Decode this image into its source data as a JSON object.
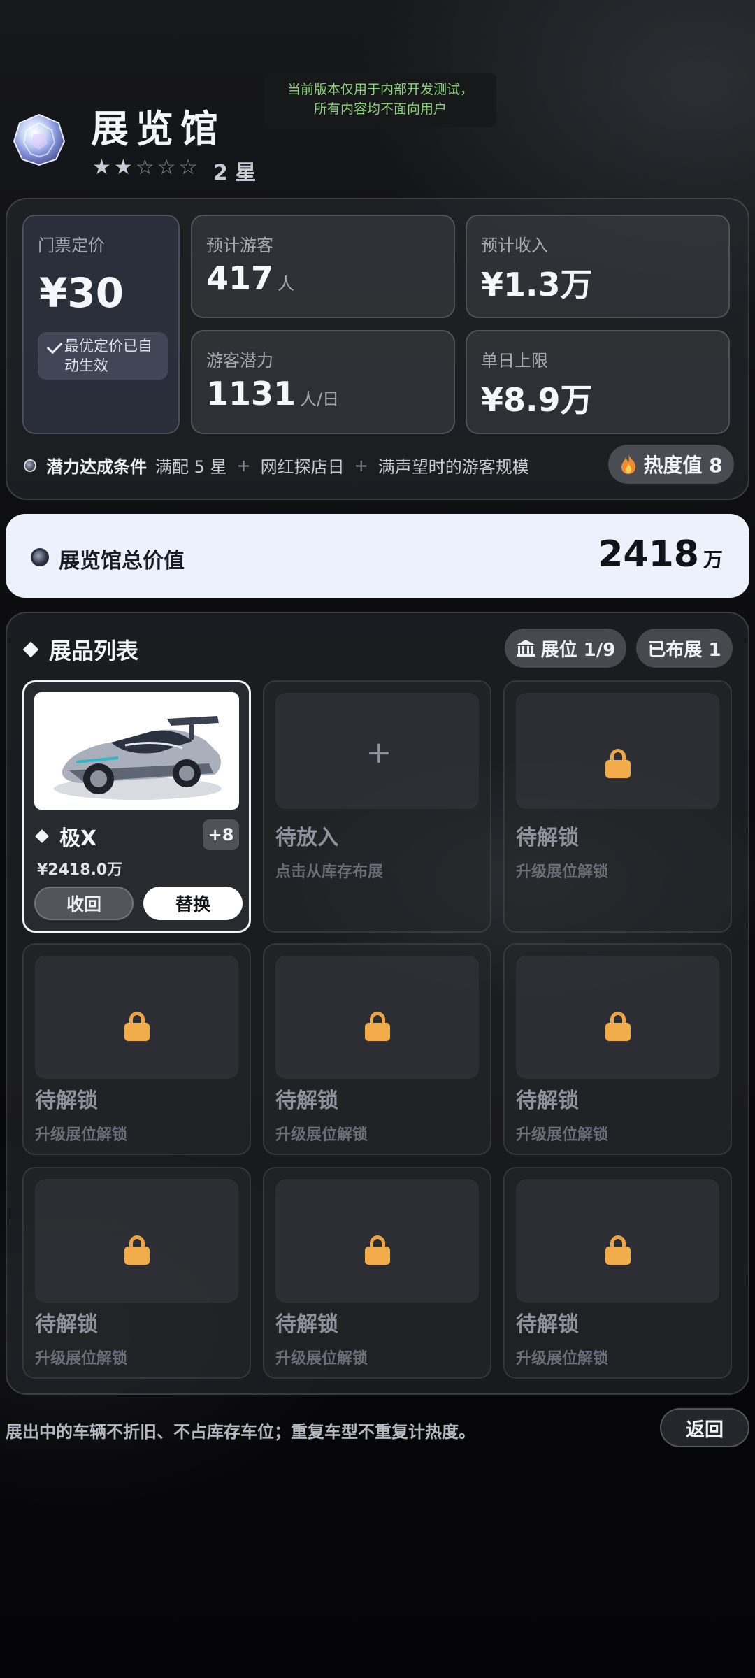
{
  "header": {
    "title": "展览馆",
    "stars_filled": 2,
    "stars_total": 5,
    "star_label": "2 星",
    "notice_line1": "当前版本仅用于内部开发测试，",
    "notice_line2": "所有内容均不面向用户"
  },
  "stats": {
    "ticket_label": "门票定价",
    "ticket_price": "¥30",
    "optimal_note": "最优定价已自动生效",
    "visitors_label": "预计游客",
    "visitors_value": "417",
    "visitors_unit": "人",
    "income_label": "预计收入",
    "income_value": "¥1.3万",
    "potential_label": "游客潜力",
    "potential_value": "1131",
    "potential_unit": "人/日",
    "daily_cap_label": "单日上限",
    "daily_cap_value": "¥8.9万"
  },
  "condition": {
    "label": "潜力达成条件",
    "items": [
      "满配 5 星",
      "网红探店日",
      "满声望时的游客规模"
    ],
    "sep": "+"
  },
  "heat": {
    "icon": "fire-icon",
    "label": "热度值 8"
  },
  "total": {
    "label": "展览馆总价值",
    "value": "2418",
    "unit": "万"
  },
  "exhibits": {
    "title": "展品列表",
    "slots_label": "展位 1/9",
    "placed_label": "已布展 1",
    "car": {
      "name": "极X",
      "plus": "+8",
      "price": "¥2418.0万",
      "recall_label": "收回",
      "replace_label": "替换"
    },
    "empty_slot": {
      "title": "待放入",
      "sub": "点击从库存布展"
    },
    "locked_slot": {
      "title": "待解锁",
      "sub": "升级展位解锁"
    }
  },
  "footer": {
    "note": "展出中的车辆不折旧、不占库存车位；重复车型不重复计热度。",
    "back_label": "返回"
  },
  "colors": {
    "accent_lock": "#f2ad4a",
    "notice_green": "#8fd17f",
    "panel_light": "#edf1fb"
  }
}
